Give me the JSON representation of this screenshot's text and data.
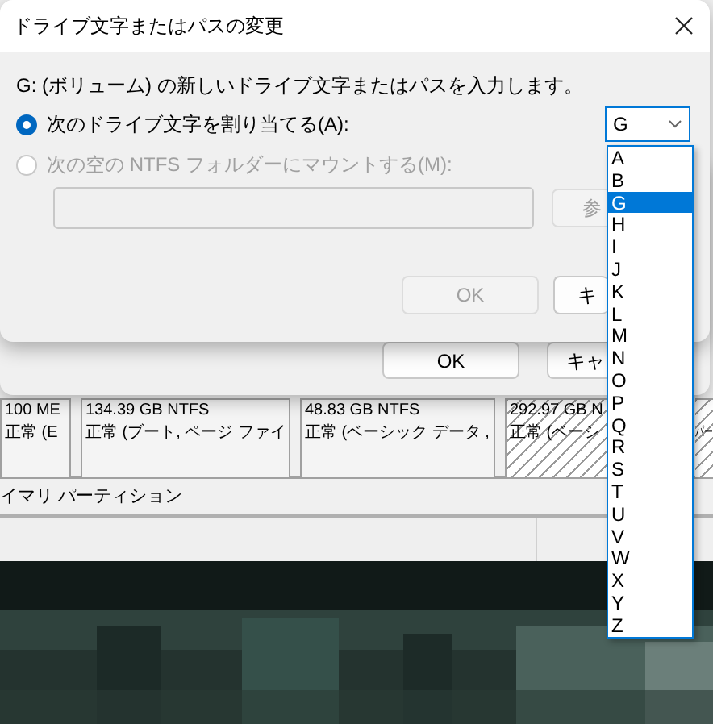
{
  "dialog": {
    "title": "ドライブ文字またはパスの変更",
    "instruction": "G: (ボリューム) の新しいドライブ文字またはパスを入力します。",
    "options": [
      {
        "label": "次のドライブ文字を割り当てる(A):",
        "selected": true,
        "disabled": false
      },
      {
        "label": "次の空の NTFS フォルダーにマウントする(M):",
        "selected": false,
        "disabled": true
      }
    ],
    "drive_letter": {
      "value": "G",
      "expanded": true,
      "options": [
        {
          "label": "A",
          "selected": false
        },
        {
          "label": "B",
          "selected": false
        },
        {
          "label": "G",
          "selected": true
        },
        {
          "label": "H",
          "selected": false
        },
        {
          "label": "I",
          "selected": false
        },
        {
          "label": "J",
          "selected": false
        },
        {
          "label": "K",
          "selected": false
        },
        {
          "label": "L",
          "selected": false
        },
        {
          "label": "M",
          "selected": false
        },
        {
          "label": "N",
          "selected": false
        },
        {
          "label": "O",
          "selected": false
        },
        {
          "label": "P",
          "selected": false
        },
        {
          "label": "Q",
          "selected": false
        },
        {
          "label": "R",
          "selected": false
        },
        {
          "label": "S",
          "selected": false
        },
        {
          "label": "T",
          "selected": false
        },
        {
          "label": "U",
          "selected": false
        },
        {
          "label": "V",
          "selected": false
        },
        {
          "label": "W",
          "selected": false
        },
        {
          "label": "X",
          "selected": false
        },
        {
          "label": "Y",
          "selected": false
        },
        {
          "label": "Z",
          "selected": false
        }
      ]
    },
    "folder_path": {
      "disabled": true
    },
    "browse_button": {
      "label": "参",
      "disabled": true
    },
    "buttons": [
      {
        "label": "OK",
        "disabled": true
      },
      {
        "label": "キ",
        "disabled": false
      }
    ]
  },
  "parent_dialog": {
    "buttons": [
      {
        "label": "OK"
      },
      {
        "label": "キャ"
      }
    ]
  },
  "partitions": [
    {
      "size": "100 ME",
      "status": "正常 (E",
      "hatched": false
    },
    {
      "size": "134.39 GB NTFS",
      "status": "正常 (ブート, ページ ファイ",
      "hatched": false
    },
    {
      "size": "48.83 GB NTFS",
      "status": "正常 (ベーシック データ ,",
      "hatched": false
    },
    {
      "size": "292.97 GB N",
      "status": "正常 (ベーシ",
      "hatched": true
    },
    {
      "status": "パー",
      "hatched": true
    }
  ],
  "legend": "イマリ パーティション"
}
